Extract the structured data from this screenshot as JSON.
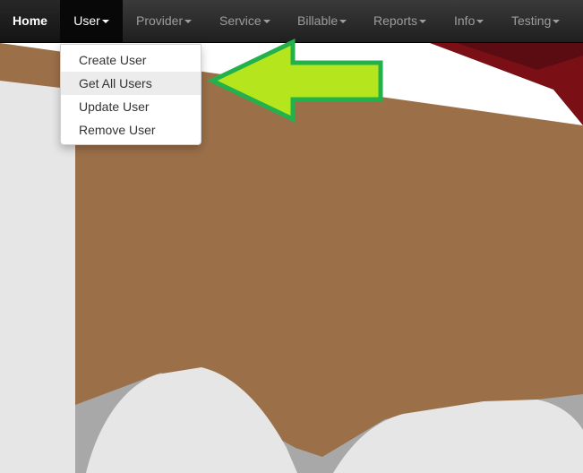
{
  "navbar": {
    "items": [
      {
        "label": "Home",
        "has_caret": false,
        "state": "normal"
      },
      {
        "label": "User",
        "has_caret": true,
        "state": "open"
      },
      {
        "label": "Provider",
        "has_caret": true,
        "state": "normal"
      },
      {
        "label": "Service",
        "has_caret": true,
        "state": "normal"
      },
      {
        "label": "Billable",
        "has_caret": true,
        "state": "normal"
      },
      {
        "label": "Reports",
        "has_caret": true,
        "state": "normal"
      },
      {
        "label": "Info",
        "has_caret": true,
        "state": "normal"
      },
      {
        "label": "Testing",
        "has_caret": true,
        "state": "normal"
      }
    ]
  },
  "user_menu": {
    "items": [
      {
        "label": "Create User"
      },
      {
        "label": "Get All Users",
        "highlighted": true
      },
      {
        "label": "Update User"
      },
      {
        "label": "Remove User"
      }
    ]
  },
  "annotation": {
    "icon": "arrow-left-icon",
    "fill_color": "#b5e61d",
    "stroke_color": "#22b14c"
  },
  "colors": {
    "navbar_bg": "#2b2b2b",
    "active_nav_bg": "#080808",
    "inactive_nav_text": "#9d9d9d",
    "active_nav_text": "#ffffff",
    "menu_highlight": "#ececec",
    "scene_brown": "#9b7049",
    "scene_light_gray": "#e6e6e6",
    "scene_dark_red": "#7a1016"
  }
}
